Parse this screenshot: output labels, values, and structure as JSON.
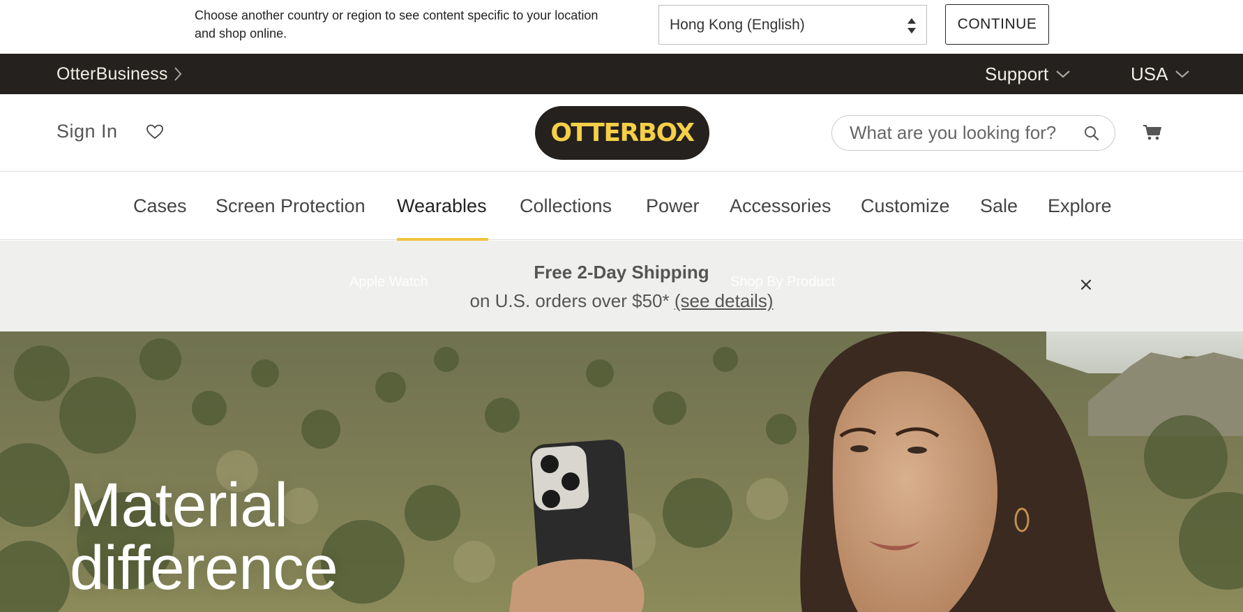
{
  "country_banner": {
    "message": "Choose another country or region to see content specific to your location and shop online.",
    "selected_region": "Hong Kong (English)",
    "continue_label": "CONTINUE"
  },
  "utility_bar": {
    "business_link": "OtterBusiness",
    "support_label": "Support",
    "country_label": "USA"
  },
  "header": {
    "sign_in_label": "Sign In",
    "logo_text": "OTTERBOX",
    "search_placeholder": "What are you looking for?"
  },
  "nav": {
    "items": [
      {
        "label": "Cases"
      },
      {
        "label": "Screen Protection"
      },
      {
        "label": "Wearables"
      },
      {
        "label": "Collections"
      },
      {
        "label": "Power"
      },
      {
        "label": "Accessories"
      },
      {
        "label": "Customize"
      },
      {
        "label": "Sale"
      },
      {
        "label": "Explore"
      }
    ],
    "active": "Wearables"
  },
  "promo": {
    "ghost_submenu": [
      "Apple Watch",
      "Shop By Product"
    ],
    "title": "Free 2-Day Shipping",
    "subtitle": "on U.S. orders over $50*",
    "link_label": "(see details)"
  },
  "hero": {
    "title_line1": "Material",
    "title_line2": "difference"
  },
  "colors": {
    "brand_yellow": "#f5cf47",
    "dark_bar": "#24211f",
    "nav_underline": "#f0c43c",
    "promo_bg": "#efefed"
  }
}
